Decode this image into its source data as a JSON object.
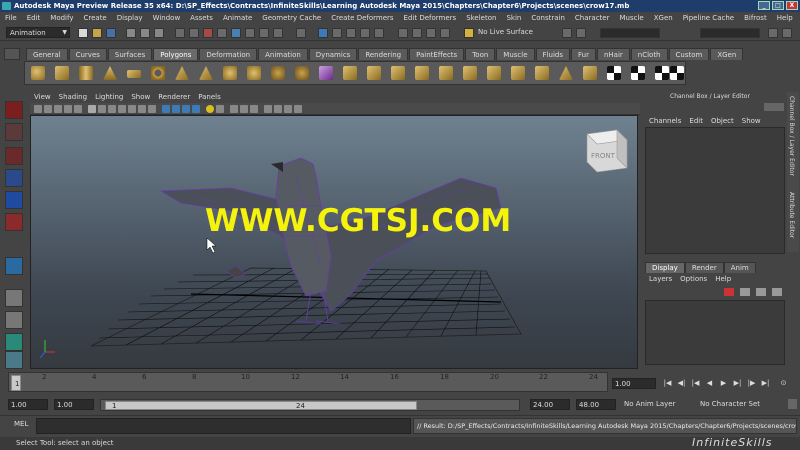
{
  "window": {
    "title": "Autodesk Maya Preview Release 35 x64: D:\\SP_Effects\\Contracts\\InfiniteSkills\\Learning Autodesk Maya 2015\\Chapters\\Chapter6\\Projects\\scenes\\crow17.mb",
    "min": "_",
    "max": "□",
    "close": "X"
  },
  "menubar": [
    "File",
    "Edit",
    "Modify",
    "Create",
    "Display",
    "Window",
    "Assets",
    "Animate",
    "Geometry Cache",
    "Create Deformers",
    "Edit Deformers",
    "Skeleton",
    "Skin",
    "Constrain",
    "Character",
    "Muscle",
    "XGen",
    "Pipeline Cache",
    "Bifrost",
    "Help"
  ],
  "statusline": {
    "mode": "Animation",
    "live_surface": "No Live Surface"
  },
  "shelf_tabs": [
    "General",
    "Curves",
    "Surfaces",
    "Polygons",
    "Deformation",
    "Animation",
    "Dynamics",
    "Rendering",
    "PaintEffects",
    "Toon",
    "Muscle",
    "Fluids",
    "Fur",
    "nHair",
    "nCloth",
    "Custom",
    "XGen"
  ],
  "active_shelf_tab": "Polygons",
  "panel_menu": [
    "View",
    "Shading",
    "Lighting",
    "Show",
    "Renderer",
    "Panels"
  ],
  "viewcube_label": "FRONT",
  "viewport_watermark": "WWW.CGTSJ.COM",
  "channel_box": {
    "header": "Channel Box / Layer Editor",
    "menu": [
      "Channels",
      "Edit",
      "Object",
      "Show"
    ]
  },
  "side_tabs": [
    "Channel Box / Layer Editor",
    "Attribute Editor"
  ],
  "layer_editor": {
    "tabs": [
      "Display",
      "Render",
      "Anim"
    ],
    "menu": [
      "Layers",
      "Options",
      "Help"
    ]
  },
  "time_slider": {
    "ticks": [
      "1",
      "2",
      "4",
      "6",
      "8",
      "10",
      "12",
      "14",
      "16",
      "18",
      "20",
      "22",
      "24"
    ],
    "current_frame": "1.00"
  },
  "range": {
    "start": "1.00",
    "current": "1.00",
    "inner_start": "1",
    "inner_end": "24",
    "end": "24.00",
    "max": "48.00",
    "anim_layer": "No Anim Layer",
    "character_set": "No Character Set"
  },
  "command_line": {
    "label": "MEL",
    "result": "// Result: D:/SP_Effects/Contracts/InfiniteSkills/Learning Autodesk Maya 2015/Chapters/Chapter6/Projects/scenes/crow17"
  },
  "help_line": "Select Tool: select an object",
  "brand": "InfiniteSkills"
}
